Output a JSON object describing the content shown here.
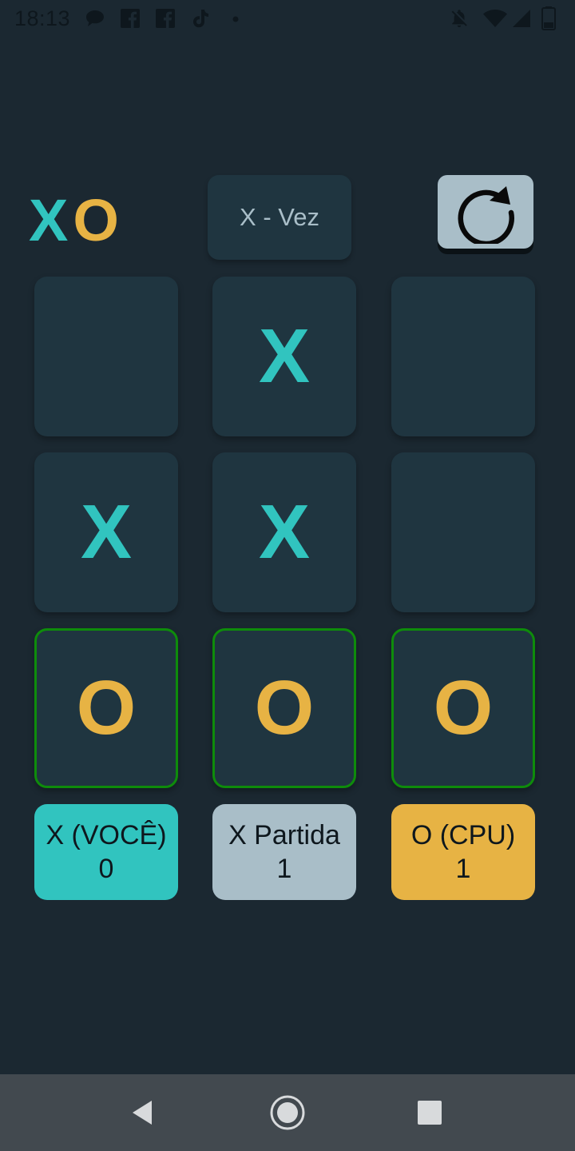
{
  "status_bar": {
    "time": "18:13",
    "icons": [
      "chat-bubble-icon",
      "facebook-icon",
      "facebook-icon",
      "tiktok-icon",
      "dot-icon",
      "notifications-off-icon",
      "wifi-icon",
      "signal-icon",
      "battery-icon"
    ]
  },
  "header": {
    "logo_x": "X",
    "logo_o": "O",
    "turn_label": "X - Vez",
    "reset_icon": "restart-icon"
  },
  "board": {
    "cells": [
      "",
      "X",
      "",
      "X",
      "X",
      "",
      "O",
      "O",
      "O"
    ],
    "winning_row": [
      6,
      7,
      8
    ]
  },
  "score": {
    "player": {
      "label": "X (VOCÊ)",
      "value": "0"
    },
    "ties": {
      "label": "X Partida",
      "value": "1"
    },
    "cpu": {
      "label": "O (CPU)",
      "value": "1"
    }
  },
  "nav_bar": {
    "icons": [
      "back-icon",
      "home-icon",
      "recents-icon"
    ]
  },
  "colors": {
    "background": "#1b2831",
    "tile": "#1f3540",
    "x": "#31c4bf",
    "o": "#e7b344",
    "silver": "#a9bec8",
    "win_border": "#0e8c0b"
  }
}
